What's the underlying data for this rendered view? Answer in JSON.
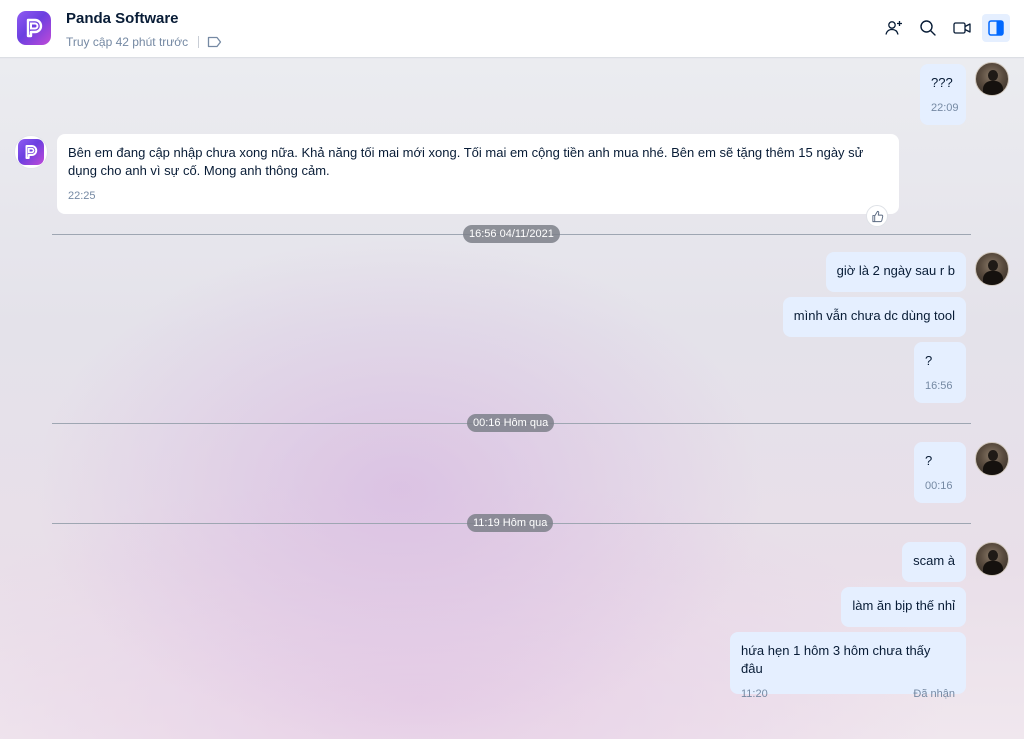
{
  "header": {
    "title": "Panda Software",
    "status": "Truy cập 42 phút trước",
    "icons": [
      "add-member-icon",
      "search-icon",
      "video-call-icon",
      "sidebar-toggle-icon"
    ]
  },
  "messages": {
    "m1": {
      "text": "???",
      "time": "22:09"
    },
    "m2": {
      "text": "Bên em đang cập nhập chưa xong nữa. Khả năng tối mai mới xong. Tối mai em cộng tiền anh mua nhé. Bên em sẽ tặng thêm 15 ngày sử dụng cho anh vì sự cố. Mong anh thông cảm.",
      "time": "22:25"
    },
    "m3": {
      "text": "giờ là 2 ngày sau r b"
    },
    "m4": {
      "text": "mình vẫn chưa dc dùng tool"
    },
    "m5": {
      "text": "?",
      "time": "16:56"
    },
    "m6": {
      "text": "?",
      "time": "00:16"
    },
    "m7": {
      "text": "scam à"
    },
    "m8": {
      "text": "làm ăn bịp thế nhỉ"
    },
    "m9": {
      "text": "hứa hẹn 1 hôm 3 hôm chưa thấy đâu",
      "time": "11:20",
      "status": "Đã nhận"
    }
  },
  "separators": {
    "s1": "16:56 04/11/2021",
    "s2": "00:16 Hôm qua",
    "s3": "11:19 Hôm qua"
  },
  "colors": {
    "my_bubble": "#e5efff",
    "their_bubble": "#ffffff",
    "accent": "#0068ff",
    "brand": "#7b4ae6"
  }
}
